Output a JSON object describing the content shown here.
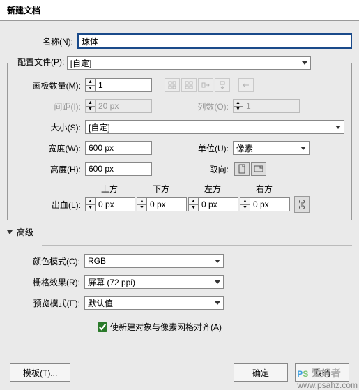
{
  "title": "新建文档",
  "name": {
    "label": "名称(N):",
    "value": "球体"
  },
  "profile": {
    "label": "配置文件(P):",
    "value": "[自定]"
  },
  "artboards": {
    "count_label": "画板数量(M):",
    "count": "1",
    "spacing_label": "间距(I):",
    "spacing": "20 px",
    "columns_label": "列数(O):",
    "columns": "1"
  },
  "size": {
    "label": "大小(S):",
    "value": "[自定]"
  },
  "width": {
    "label": "宽度(W):",
    "value": "600 px"
  },
  "height": {
    "label": "高度(H):",
    "value": "600 px"
  },
  "unit": {
    "label": "单位(U):",
    "value": "像素"
  },
  "orientation_label": "取向:",
  "bleed": {
    "label": "出血(L):",
    "top": "上方",
    "bottom": "下方",
    "left": "左方",
    "right": "右方",
    "value": "0 px"
  },
  "advanced": {
    "header": "高级",
    "color_mode": {
      "label": "颜色模式(C):",
      "value": "RGB"
    },
    "raster": {
      "label": "栅格效果(R):",
      "value": "屏幕 (72 ppi)"
    },
    "preview": {
      "label": "预览模式(E):",
      "value": "默认值"
    },
    "align_pixel": "使新建对象与像素网格对齐(A)"
  },
  "buttons": {
    "template": "模板(T)...",
    "ok": "确定",
    "cancel": "取消"
  },
  "watermark": {
    "site": "www.psahz.com",
    "name": "爱好者"
  }
}
